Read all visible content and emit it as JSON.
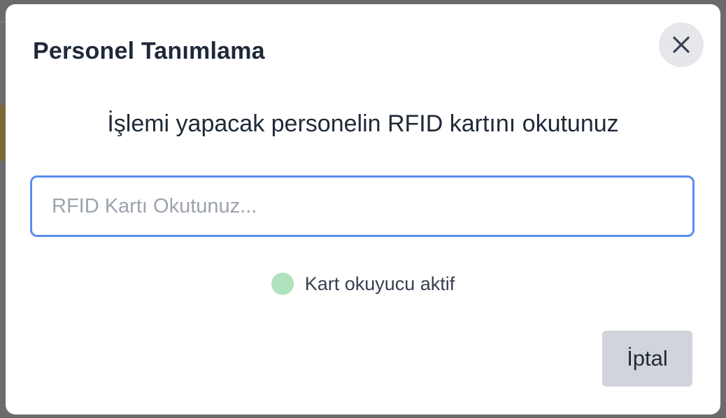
{
  "modal": {
    "title": "Personel Tanımlama",
    "instruction": "İşlemi yapacak personelin RFID kartını okutunuz",
    "rfid_input": {
      "value": "",
      "placeholder": "RFID Kartı Okutunuz..."
    },
    "status": {
      "text": "Kart okuyucu aktif",
      "color": "#b0e2bd"
    },
    "cancel_label": "İptal",
    "close_icon": "close-icon"
  },
  "colors": {
    "accent": "#5b8def",
    "status_active": "#b0e2bd"
  }
}
